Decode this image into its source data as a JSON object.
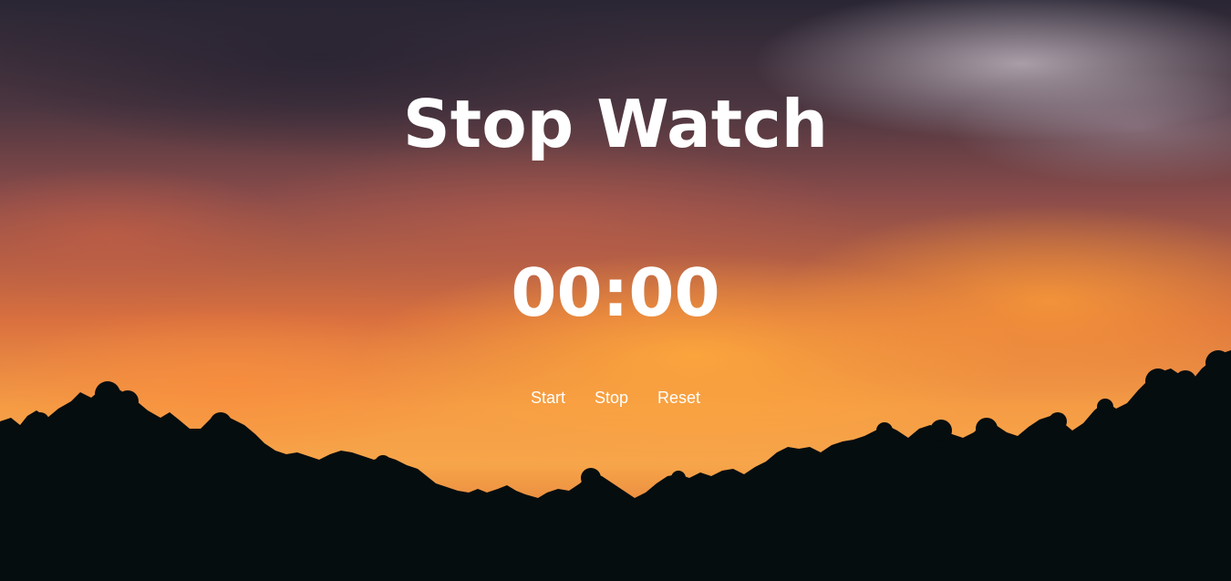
{
  "title": "Stop Watch",
  "timer": {
    "display": "00:00"
  },
  "controls": {
    "start_label": "Start",
    "stop_label": "Stop",
    "reset_label": "Reset"
  },
  "colors": {
    "text": "#ffffff",
    "silhouette": "#060d0f",
    "sky_orange": "#f59c45",
    "sky_dark": "#2a2634"
  }
}
